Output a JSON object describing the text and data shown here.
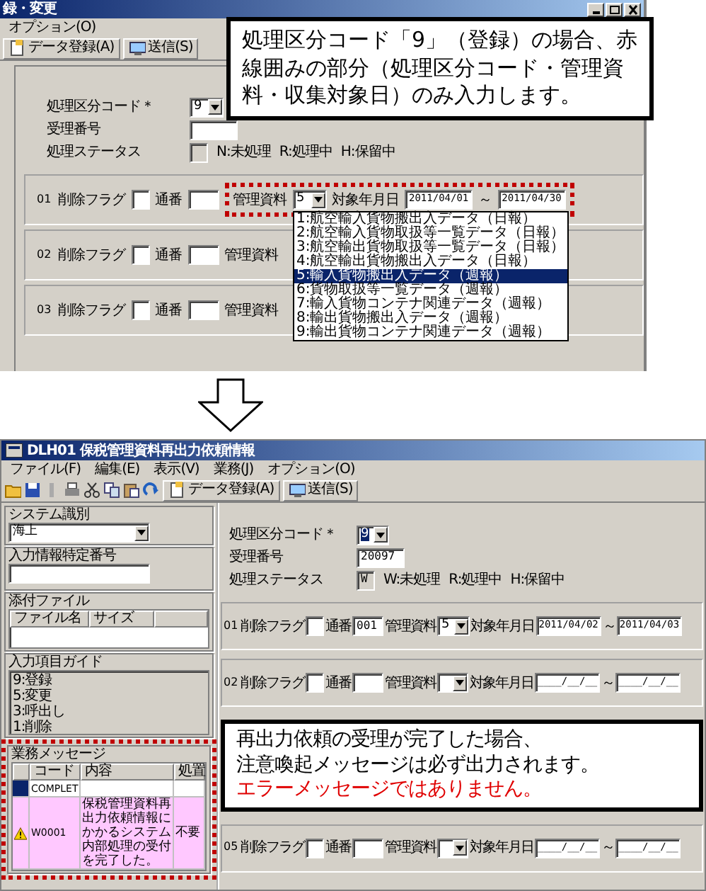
{
  "top_window": {
    "title": "録・変更",
    "menu": [
      "オプション(O)"
    ],
    "toolbar": [
      {
        "label": "データ登録(A)"
      },
      {
        "label": "送信(S)"
      }
    ],
    "fields": [
      {
        "kind": "select",
        "label": "処理区分コード＊",
        "value": "9",
        "value_selected": false
      },
      {
        "kind": "text",
        "label": "受理番号"
      },
      {
        "kind": "status",
        "label": "処理ステータス",
        "legend": [
          "N:未処理",
          "R:処理中",
          "H:保留中"
        ]
      }
    ],
    "rows": [
      {
        "number": "01",
        "items": [
          {
            "kind": "label",
            "text": "削除フラグ"
          },
          {
            "kind": "checkbox",
            "checked": false
          },
          {
            "kind": "label",
            "text": "通番"
          },
          {
            "kind": "input"
          },
          {
            "kind": "frame",
            "items": [
              {
                "kind": "label",
                "text": "管理資料"
              },
              {
                "kind": "select",
                "value": "5",
                "open_list": [
                  {
                    "label": "1:航空輸入貨物搬出入データ（日報）",
                    "selected": false
                  },
                  {
                    "label": "2:航空輸入貨物取扱等一覧データ（日報）",
                    "selected": false
                  },
                  {
                    "label": "3:航空輸出貨物取扱等一覧データ（日報）",
                    "selected": false
                  },
                  {
                    "label": "4:航空輸出貨物搬出入データ（日報）",
                    "selected": false
                  },
                  {
                    "label": "5:輸入貨物搬出入データ（週報）",
                    "selected": true
                  },
                  {
                    "label": "6:貨物取扱等一覧データ（週報）",
                    "selected": false
                  },
                  {
                    "label": "7:輸入貨物コンテナ関連データ（週報）",
                    "selected": false
                  },
                  {
                    "label": "8:輸出貨物搬出入データ（週報）",
                    "selected": false
                  },
                  {
                    "label": "9:輸出貨物コンテナ関連データ（週報）",
                    "selected": false
                  }
                ]
              },
              {
                "kind": "label",
                "text": "対象年月日"
              },
              {
                "kind": "date",
                "value": "2011/04/01"
              },
              {
                "kind": "label",
                "text": "～"
              },
              {
                "kind": "date",
                "value": "2011/04/30"
              }
            ]
          }
        ]
      },
      {
        "number": "02",
        "items": [
          {
            "kind": "label",
            "text": "削除フラグ"
          },
          {
            "kind": "checkbox",
            "checked": false
          },
          {
            "kind": "label",
            "text": "通番"
          },
          {
            "kind": "input"
          },
          {
            "kind": "label",
            "text": "管理資料"
          }
        ]
      },
      {
        "number": "03",
        "items": [
          {
            "kind": "label",
            "text": "削除フラグ"
          },
          {
            "kind": "checkbox",
            "checked": false
          },
          {
            "kind": "label",
            "text": "通番"
          },
          {
            "kind": "input"
          },
          {
            "kind": "label",
            "text": "管理資料"
          }
        ]
      }
    ]
  },
  "callout_top": {
    "text": "処理区分コード「9」（登録）の場合、赤線囲みの部分（処理区分コード・管理資料・収集対象日）のみ入力します。"
  },
  "bottom_window": {
    "title": "DLH01 保税管理資料再出力依頼情報",
    "menu": [
      "ファイル(F)",
      "編集(E)",
      "表示(V)",
      "業務(J)",
      "オプション(O)"
    ],
    "toolbar": [
      {
        "label": "データ登録(A)"
      },
      {
        "label": "送信(S)"
      }
    ],
    "left_panel": {
      "system": {
        "caption": "システム識別",
        "value": "海上"
      },
      "input_id": {
        "caption": "入力情報特定番号"
      },
      "attachments": {
        "caption": "添付ファイル",
        "columns": [
          "ファイル名",
          "サイズ"
        ]
      },
      "guide": {
        "caption": "入力項目ガイド",
        "lines": [
          "9:登録",
          "5:変更",
          "3:呼出し",
          "1:削除"
        ]
      },
      "messages": {
        "caption": "業務メッセージ",
        "framed": true,
        "columns": [
          "コード",
          "内容",
          "処置"
        ],
        "rows": [
          {
            "kind": "complete",
            "selected": true,
            "code": "COMPLET"
          },
          {
            "kind": "warning",
            "selected": false,
            "code": "W0001",
            "content": "保税管理資料再出力依頼情報にかかるシステム内部処理の受付を完了した。",
            "action": "不要"
          }
        ]
      }
    },
    "fields": [
      {
        "kind": "select",
        "label": "処理区分コード＊",
        "value": "9",
        "value_selected": true
      },
      {
        "kind": "text",
        "label": "受理番号",
        "value": "20097"
      },
      {
        "kind": "status",
        "label": "処理ステータス",
        "value": "W",
        "legend": [
          "W:未処理",
          "R:処理中",
          "H:保留中"
        ]
      }
    ],
    "rows": [
      {
        "number": "01",
        "items": [
          {
            "kind": "label",
            "text": "削除フラグ"
          },
          {
            "kind": "checkbox",
            "checked": false
          },
          {
            "kind": "label",
            "text": "通番"
          },
          {
            "kind": "input",
            "value": "001"
          },
          {
            "kind": "label",
            "text": "管理資料"
          },
          {
            "kind": "select",
            "value": "5"
          },
          {
            "kind": "label",
            "text": "対象年月日"
          },
          {
            "kind": "date",
            "value": "2011/04/02"
          },
          {
            "kind": "label",
            "text": "～"
          },
          {
            "kind": "date",
            "value": "2011/04/03"
          }
        ]
      },
      {
        "number": "02",
        "items": [
          {
            "kind": "label",
            "text": "削除フラグ"
          },
          {
            "kind": "checkbox",
            "checked": false
          },
          {
            "kind": "label",
            "text": "通番"
          },
          {
            "kind": "input"
          },
          {
            "kind": "label",
            "text": "管理資料"
          },
          {
            "kind": "select"
          },
          {
            "kind": "label",
            "text": "対象年月日"
          },
          {
            "kind": "date",
            "value": "____/__/__"
          },
          {
            "kind": "label",
            "text": "～"
          },
          {
            "kind": "date",
            "value": "____/__/__"
          }
        ]
      },
      {
        "kind": "callout",
        "lines": [
          {
            "text": "再出力依頼の受理が完了した場合、",
            "kind": "normal"
          },
          {
            "text": "注意喚起メッセージは必ず出力されます。",
            "kind": "normal"
          },
          {
            "text": "エラーメッセージではありません。",
            "kind": "alert"
          }
        ]
      },
      {
        "number": "05",
        "items": [
          {
            "kind": "label",
            "text": "削除フラグ"
          },
          {
            "kind": "checkbox",
            "checked": false
          },
          {
            "kind": "label",
            "text": "通番"
          },
          {
            "kind": "input"
          },
          {
            "kind": "label",
            "text": "管理資料"
          },
          {
            "kind": "select"
          },
          {
            "kind": "label",
            "text": "対象年月日"
          },
          {
            "kind": "date",
            "value": "____/__/__"
          },
          {
            "kind": "label",
            "text": "～"
          },
          {
            "kind": "date",
            "value": "____/__/__"
          }
        ]
      }
    ]
  }
}
